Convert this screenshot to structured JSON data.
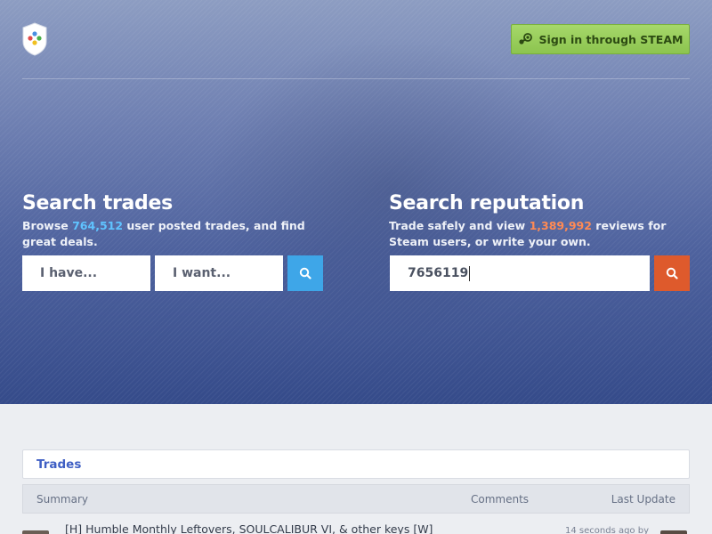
{
  "header": {
    "sign_in_label": "Sign in through STEAM",
    "icons": {
      "logo": "shield-controller-icon",
      "steam": "steam-icon"
    }
  },
  "search_trades": {
    "title": "Search trades",
    "desc_prefix": "Browse ",
    "count": "764,512",
    "desc_suffix": " user posted trades, and find great deals.",
    "have_placeholder": "I have...",
    "want_placeholder": "I want...",
    "button_icon": "search-icon"
  },
  "search_reputation": {
    "title": "Search reputation",
    "desc_prefix": "Trade safely and view ",
    "count": "1,389,992",
    "desc_suffix": " reviews for Steam users, or write your own.",
    "input_value": "7656119",
    "button_icon": "search-icon"
  },
  "panel": {
    "tab_label": "Trades"
  },
  "table": {
    "columns": [
      "Summary",
      "Comments",
      "Last Update"
    ],
    "rows": [
      {
        "summary": "[H] Humble Monthly Leftovers, SOULCALIBUR VI, & other keys [W]",
        "last_update": "14 seconds ago by"
      }
    ]
  },
  "colors": {
    "accent_blue": "#3ea6e8",
    "accent_orange": "#de5a2c",
    "steam_green": "#8cc44f",
    "link_blue": "#3f5fc4",
    "highlight_blue": "#5fc3ff",
    "highlight_orange": "#ff8a54"
  }
}
